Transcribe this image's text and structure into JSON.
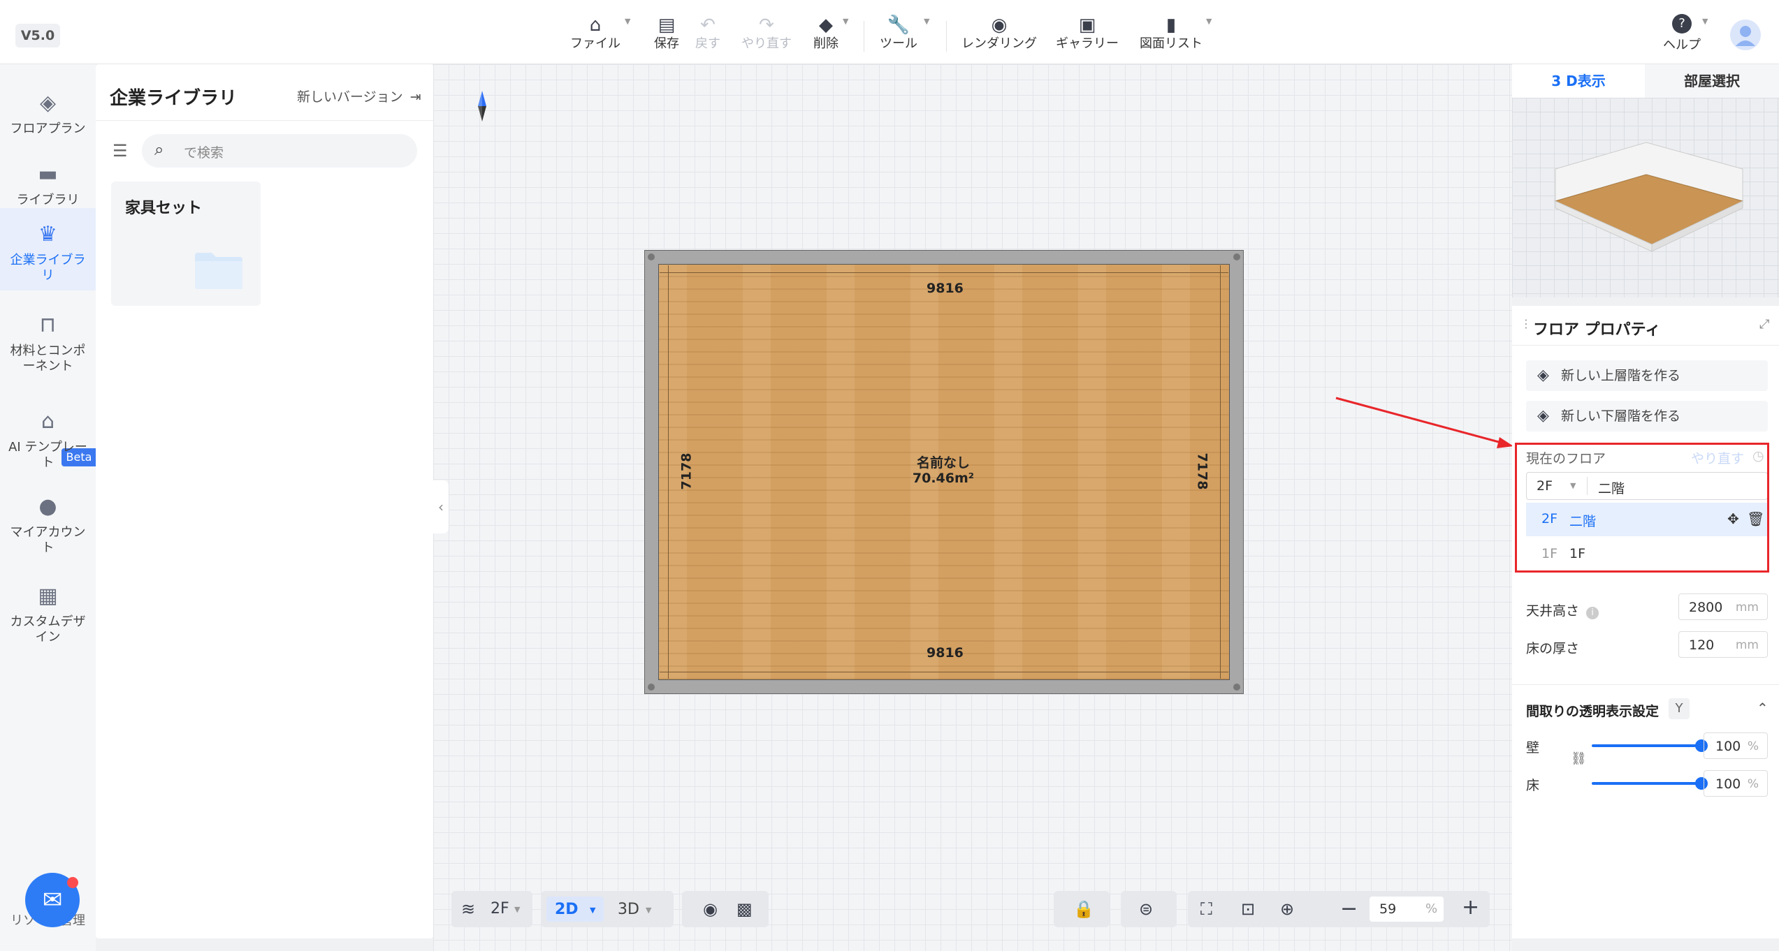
{
  "app": {
    "version": "V5.0"
  },
  "toolbar": {
    "items": [
      {
        "label": "ファイル",
        "icon": "home-file-icon",
        "enabled": true
      },
      {
        "label": "保存",
        "icon": "save-icon",
        "enabled": true
      },
      {
        "label": "戻す",
        "icon": "undo-icon",
        "enabled": false
      },
      {
        "label": "やり直す",
        "icon": "redo-icon",
        "enabled": false
      },
      {
        "label": "削除",
        "icon": "eraser-icon",
        "enabled": true
      },
      {
        "label": "ツール",
        "icon": "wrench-icon",
        "enabled": true
      },
      {
        "label": "レンダリング",
        "icon": "camera-icon",
        "enabled": true
      },
      {
        "label": "ギャラリー",
        "icon": "gallery-icon",
        "enabled": true
      },
      {
        "label": "図面リスト",
        "icon": "document-icon",
        "enabled": true
      }
    ],
    "help_label": "ヘルプ"
  },
  "sidebar": {
    "items": [
      {
        "label": "フロアプラン",
        "icon": "floorplan-icon",
        "active": false
      },
      {
        "label": "ライブラリ",
        "icon": "sofa-icon",
        "active": false
      },
      {
        "label": "企業ライブラリ",
        "icon": "crown-icon",
        "active": true
      },
      {
        "label": "材料とコンポーネント",
        "icon": "fireplace-icon",
        "active": false
      },
      {
        "label": "AI テンプレート",
        "icon": "ai-template-icon",
        "active": false
      },
      {
        "label": "マイアカウント",
        "icon": "user-icon",
        "active": false
      },
      {
        "label": "カスタムデザイン",
        "icon": "cabinet-icon",
        "active": false
      }
    ],
    "beta_badge": "Beta",
    "bottom_label": "リソース管理"
  },
  "library": {
    "title": "企業ライブラリ",
    "new_version": "新しいバージョン",
    "search_placeholder": "で検索",
    "cards": [
      {
        "title": "家具セット"
      }
    ]
  },
  "canvas": {
    "dim_top": "9816",
    "dim_bottom": "9816",
    "dim_left": "7178",
    "dim_right": "7178",
    "room_name": "名前なし",
    "room_area": "70.46m²"
  },
  "bottombar": {
    "floor": "2F",
    "view_2d": "2D",
    "view_3d": "3D",
    "zoom": "59",
    "zoom_unit": "%"
  },
  "right_panel": {
    "tab_3d": "3 D表示",
    "tab_room": "部屋選択",
    "prop_title": "フロア プロパティ",
    "btn_new_upper": "新しい上層階を作る",
    "btn_new_lower": "新しい下層階を作る",
    "current_floor_label": "現在のフロア",
    "redo_label": "やり直す",
    "dropdown": {
      "floor": "2F",
      "name": "二階"
    },
    "floors": [
      {
        "code": "2F",
        "name": "二階",
        "selected": true
      },
      {
        "code": "1F",
        "name": "1F",
        "selected": false
      }
    ],
    "ceiling_label": "天井高さ",
    "ceiling_value": "2800",
    "floor_thick_label": "床の厚さ",
    "floor_thick_value": "120",
    "unit": "mm",
    "transparency_title": "間取りの透明表示設定",
    "transparency_key": "Y",
    "wall_label": "壁",
    "wall_value": "100",
    "floor_label": "床",
    "floor_value": "100",
    "percent": "%"
  },
  "colors": {
    "accent": "#1a6ff5",
    "annotation": "#e8262a"
  }
}
